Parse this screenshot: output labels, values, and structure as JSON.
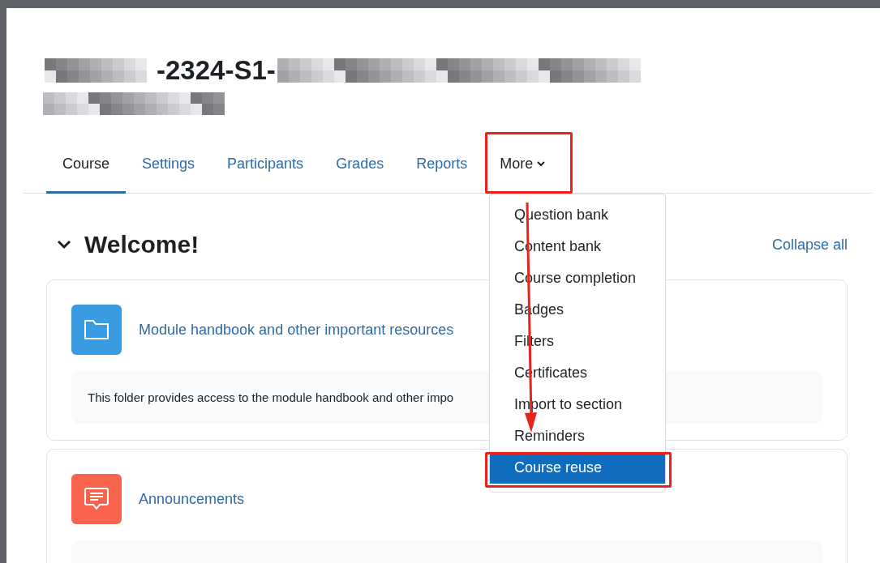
{
  "course": {
    "title_parts": [
      {
        "kind": "redacted"
      },
      {
        "kind": "text",
        "text": "-2324-S1-"
      },
      {
        "kind": "redacted"
      }
    ],
    "subtitle": {
      "kind": "redacted"
    }
  },
  "tabs": [
    {
      "label": "Course",
      "selected": true
    },
    {
      "label": "Settings",
      "selected": false
    },
    {
      "label": "Participants",
      "selected": false
    },
    {
      "label": "Grades",
      "selected": false
    },
    {
      "label": "Reports",
      "selected": false
    },
    {
      "label": "More",
      "selected": false,
      "kind": "dropdown"
    }
  ],
  "more_menu": {
    "items": [
      {
        "label": "Question bank",
        "selected": false
      },
      {
        "label": "Content bank",
        "selected": false
      },
      {
        "label": "Course completion",
        "selected": false
      },
      {
        "label": "Badges",
        "selected": false
      },
      {
        "label": "Filters",
        "selected": false
      },
      {
        "label": "Certificates",
        "selected": false
      },
      {
        "label": "Import to section",
        "selected": false
      },
      {
        "label": "Reminders",
        "selected": false
      },
      {
        "label": "Course reuse",
        "selected": true
      }
    ]
  },
  "section": {
    "title": "Welcome!",
    "expanded": true,
    "collapse_link": "Collapse all"
  },
  "activities": [
    {
      "kind": "folder",
      "color": "#399be2",
      "name": "Module handbook and other important resources",
      "description": "This folder provides access to the module handbook and other impo"
    },
    {
      "kind": "forum",
      "color": "#f7634d",
      "name": "Announcements"
    }
  ]
}
